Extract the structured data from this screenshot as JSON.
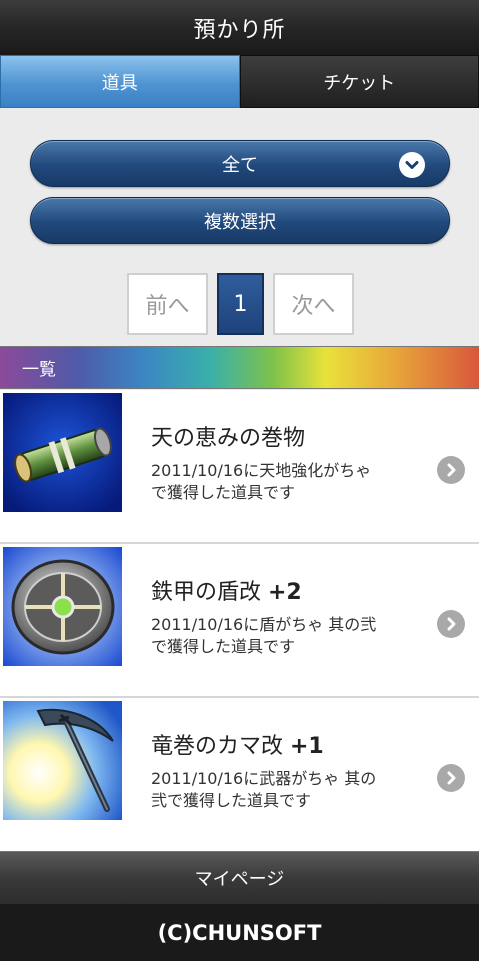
{
  "header": {
    "title": "預かり所"
  },
  "tabs": [
    {
      "label": "道具",
      "active": true
    },
    {
      "label": "チケット",
      "active": false
    }
  ],
  "filter": {
    "selected": "全て",
    "icon": "chevron-down-icon"
  },
  "multi_select": {
    "label": "複数選択"
  },
  "pager": {
    "prev": "前へ",
    "current": "1",
    "next": "次へ"
  },
  "list": {
    "heading": "一覧",
    "items": [
      {
        "name": "天の恵みの巻物",
        "plus": "",
        "desc": "2011/10/16に天地強化がちゃで獲得した道具です",
        "icon": "scroll-icon"
      },
      {
        "name": "鉄甲の盾改 ",
        "plus": "+2",
        "desc": "2011/10/16に盾がちゃ 其の弐で獲得した道具です",
        "icon": "shield-icon"
      },
      {
        "name": "竜巻のカマ改 ",
        "plus": "+1",
        "desc": "2011/10/16に武器がちゃ 其の弐で獲得した道具です",
        "icon": "sickle-icon"
      }
    ]
  },
  "nav": {
    "mypage": "マイページ"
  },
  "footer": {
    "copyright": "(C)CHUNSOFT"
  },
  "colors": {
    "tab_active": "#4f94d2",
    "pill": "#21497c",
    "page_current": "#1e437c"
  }
}
